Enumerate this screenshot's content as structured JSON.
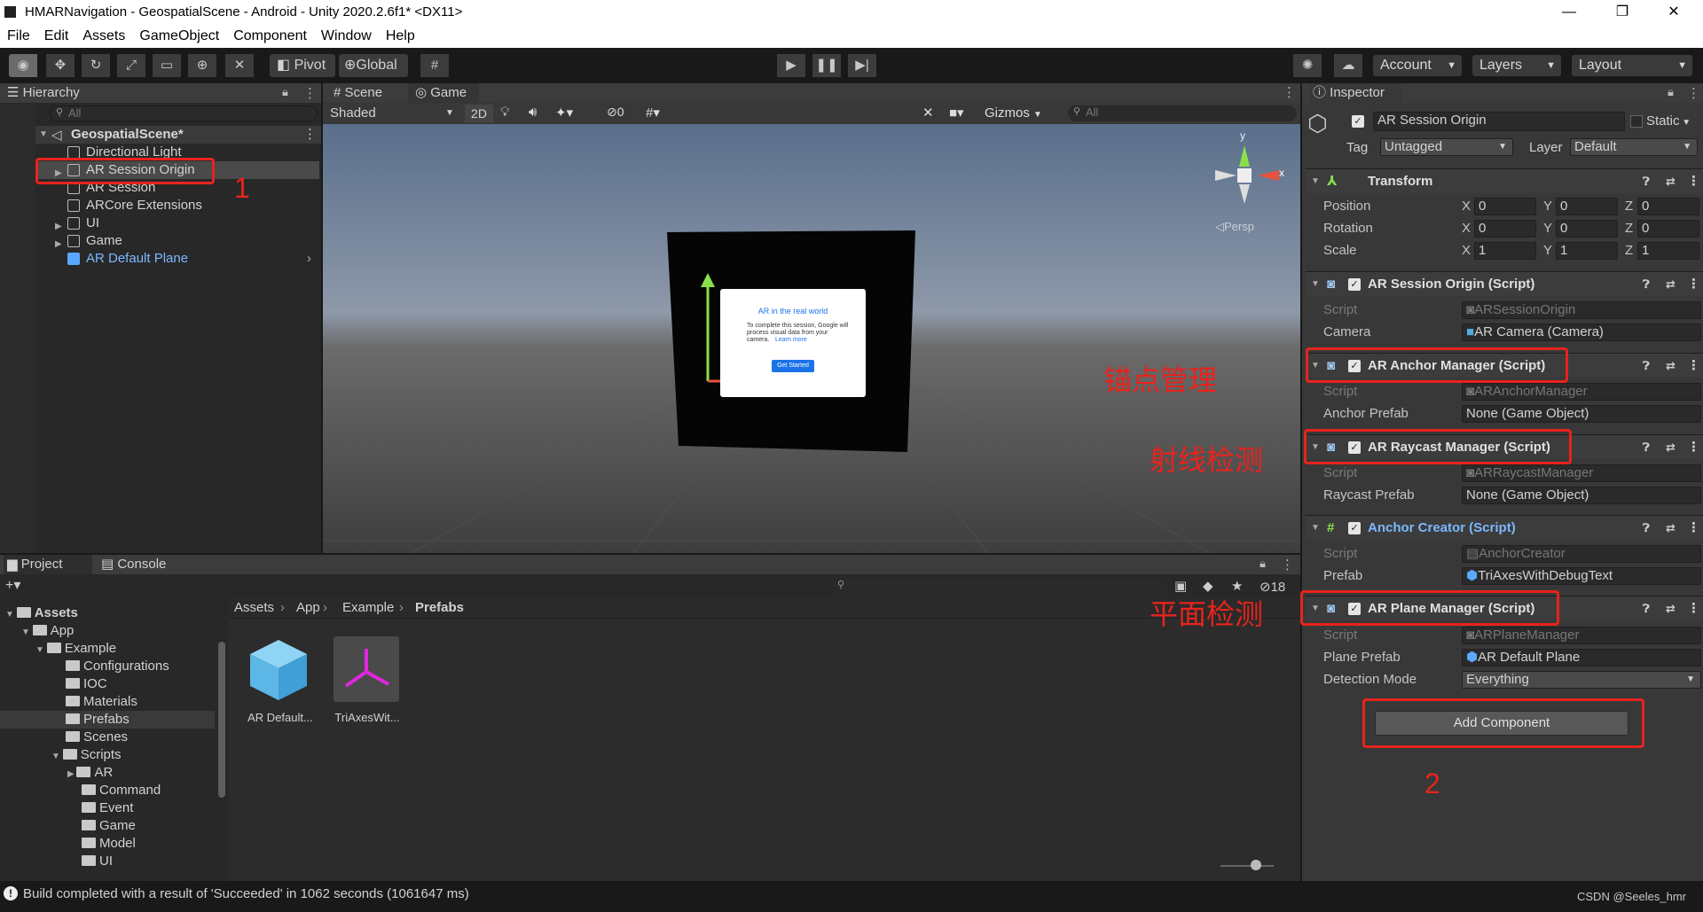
{
  "window": {
    "title": "HMARNavigation - GeospatialScene - Android - Unity 2020.2.6f1* <DX11>",
    "min": "—",
    "max": "❐",
    "close": "✕"
  },
  "menu": [
    "File",
    "Edit",
    "Assets",
    "GameObject",
    "Component",
    "Window",
    "Help"
  ],
  "toolbar": {
    "pivot": "Pivot",
    "global": "Global",
    "account": "Account",
    "layers": "Layers",
    "layout": "Layout"
  },
  "hierarchy": {
    "tab": "Hierarchy",
    "search_placeholder": "All",
    "scene": "GeospatialScene*",
    "items": [
      "Directional Light",
      "AR Session Origin",
      "AR Session",
      "ARCore Extensions",
      "UI",
      "Game",
      "AR Default Plane"
    ]
  },
  "scene_view": {
    "tabs": [
      "Scene",
      "Game"
    ],
    "shading": "Shaded",
    "mode_2d": "2D",
    "hidden_count": "0",
    "gizmos": "Gizmos",
    "search_placeholder": "All",
    "persp": "Persp",
    "axis_y": "y",
    "axis_x": "x",
    "ar_card": {
      "title": "AR in the real world",
      "body": "To complete this session, Google will",
      "body2": "process visual data from your",
      "body3": "camera.",
      "link": "Learn more",
      "button": "Get Started"
    }
  },
  "project": {
    "tabs": [
      "Project",
      "Console"
    ],
    "count": "18",
    "breadcrumb": [
      "Assets",
      "App",
      "Example",
      "Prefabs"
    ],
    "tree": [
      "Assets",
      "App",
      "Example",
      "Configurations",
      "IOC",
      "Materials",
      "Prefabs",
      "Scenes",
      "Scripts",
      "AR",
      "Command",
      "Event",
      "Game",
      "Model",
      "UI"
    ],
    "assets": [
      "AR Default...",
      "TriAxesWit..."
    ]
  },
  "inspector": {
    "tab": "Inspector",
    "object_name": "AR Session Origin",
    "static_label": "Static",
    "tag_label": "Tag",
    "tag_value": "Untagged",
    "layer_label": "Layer",
    "layer_value": "Default",
    "transform": {
      "title": "Transform",
      "rows": [
        {
          "label": "Position",
          "x": "0",
          "y": "0",
          "z": "0"
        },
        {
          "label": "Rotation",
          "x": "0",
          "y": "0",
          "z": "0"
        },
        {
          "label": "Scale",
          "x": "1",
          "y": "1",
          "z": "1"
        }
      ]
    },
    "components": [
      {
        "title": "AR Session Origin (Script)",
        "rows": [
          {
            "label": "Script",
            "value": "ARSessionOrigin"
          },
          {
            "label": "Camera",
            "value": "AR Camera (Camera)"
          }
        ]
      },
      {
        "title": "AR Anchor Manager (Script)",
        "rows": [
          {
            "label": "Script",
            "value": "ARAnchorManager"
          },
          {
            "label": "Anchor Prefab",
            "value": "None (Game Object)"
          }
        ]
      },
      {
        "title": "AR Raycast Manager (Script)",
        "rows": [
          {
            "label": "Script",
            "value": "ARRaycastManager"
          },
          {
            "label": "Raycast Prefab",
            "value": "None (Game Object)"
          }
        ]
      },
      {
        "title": "Anchor Creator (Script)",
        "rows": [
          {
            "label": "Script",
            "value": "AnchorCreator"
          },
          {
            "label": "Prefab",
            "value": "TriAxesWithDebugText"
          }
        ]
      },
      {
        "title": "AR Plane Manager (Script)",
        "rows": [
          {
            "label": "Script",
            "value": "ARPlaneManager"
          },
          {
            "label": "Plane Prefab",
            "value": "AR Default Plane"
          },
          {
            "label": "Detection Mode",
            "value": "Everything"
          }
        ]
      }
    ],
    "add_component": "Add Component"
  },
  "annotations": {
    "one": "1",
    "two": "2",
    "anchor": "锚点管理",
    "raycast": "射线检测",
    "plane": "平面检测"
  },
  "status": {
    "message": "Build completed with a result of 'Succeeded' in 1062 seconds (1061647 ms)",
    "watermark": "CSDN @Seeles_hmr"
  },
  "colors": {
    "annotation_red": "#e8231c",
    "selected_blue": "#4d78cc",
    "prefab_blue": "#7cb8ff"
  }
}
